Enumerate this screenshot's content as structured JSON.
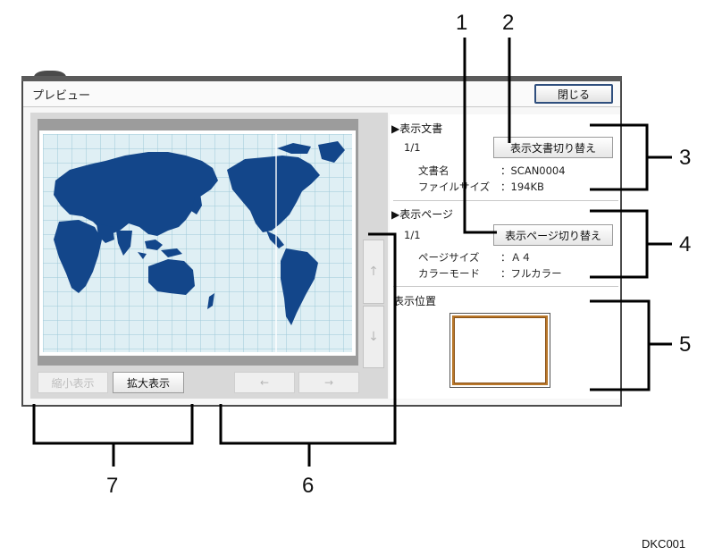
{
  "window": {
    "title": "プレビュー",
    "close_label": "閉じる"
  },
  "preview": {
    "zoom_out_label": "縮小表示",
    "zoom_in_label": "拡大表示",
    "scroll_left_icon": "arrow-left-icon",
    "scroll_right_icon": "arrow-right-icon",
    "scroll_up_icon": "arrow-up-icon",
    "scroll_down_icon": "arrow-down-icon"
  },
  "document_section": {
    "heading": "▶表示文書",
    "count": "1/1",
    "switch_label": "表示文書切り替え",
    "name_label": "文書名",
    "name_value": "：SCAN0004",
    "size_label": "ファイルサイズ",
    "size_value": "：194KB"
  },
  "page_section": {
    "heading": "▶表示ページ",
    "count": "1/1",
    "switch_label": "表示ページ切り替え",
    "page_size_label": "ページサイズ",
    "page_size_value": "：Ａ４",
    "color_mode_label": "カラーモード",
    "color_mode_value": "：フルカラー"
  },
  "position_section": {
    "heading": "表示位置"
  },
  "callouts": [
    "1",
    "2",
    "3",
    "4",
    "5",
    "6",
    "7"
  ],
  "figure_code": "DKC001",
  "colors": {
    "ocean": "#dfeff4",
    "land": "#13468a",
    "grid": "#9ec9d8",
    "thumb_border": "#b8772a"
  }
}
